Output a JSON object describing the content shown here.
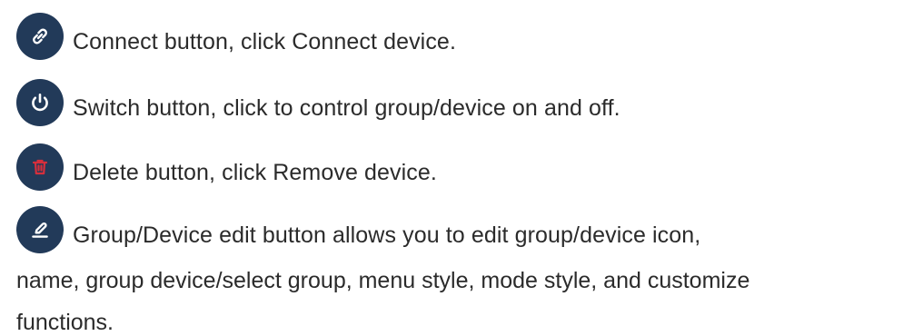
{
  "items": [
    {
      "icon": "link-icon",
      "text": "Connect button, click Connect device."
    },
    {
      "icon": "power-icon",
      "text": "Switch button, click to control group/device on and off."
    },
    {
      "icon": "trash-icon",
      "icon_color": "#d62f3c",
      "text": "Delete button, click Remove device."
    },
    {
      "icon": "edit-icon",
      "text_lines": [
        "Group/Device edit button allows you to edit group/device icon,",
        "name, group device/select group, menu style, mode style, and customize",
        "functions."
      ]
    }
  ],
  "colors": {
    "icon_background": "#223a59",
    "icon_foreground": "#ffffff",
    "delete_accent": "#d62f3c",
    "text": "#2b2b2b"
  }
}
